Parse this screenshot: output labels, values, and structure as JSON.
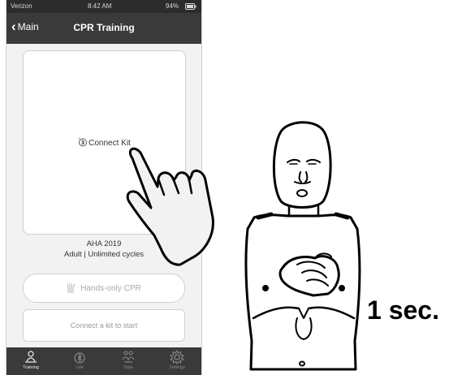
{
  "status_bar": {
    "carrier": "Verizon",
    "time": "8:42 AM",
    "battery": "94%"
  },
  "nav": {
    "back_label": "Main",
    "title": "CPR Training"
  },
  "connect_card": {
    "label": "Connect Kit"
  },
  "protocol": {
    "name": "AHA 2019",
    "details": "Adult | Unlimited cycles"
  },
  "buttons": {
    "hands_only": "Hands-only CPR",
    "start_hint": "Connect a kit to start"
  },
  "tabs": [
    {
      "label": "Training",
      "icon": "training-icon",
      "active": true
    },
    {
      "label": "Link",
      "icon": "link-icon",
      "active": false
    },
    {
      "label": "Data",
      "icon": "data-icon",
      "active": false
    },
    {
      "label": "Settings",
      "icon": "settings-icon",
      "active": false
    }
  ],
  "overlay": {
    "duration": "1 sec."
  },
  "colors": {
    "nav_bg": "#3a3a3a",
    "screen_bg": "#f2f2f2",
    "active_tab": "#f0f0f0",
    "inactive_tab": "#8a8a8a"
  }
}
